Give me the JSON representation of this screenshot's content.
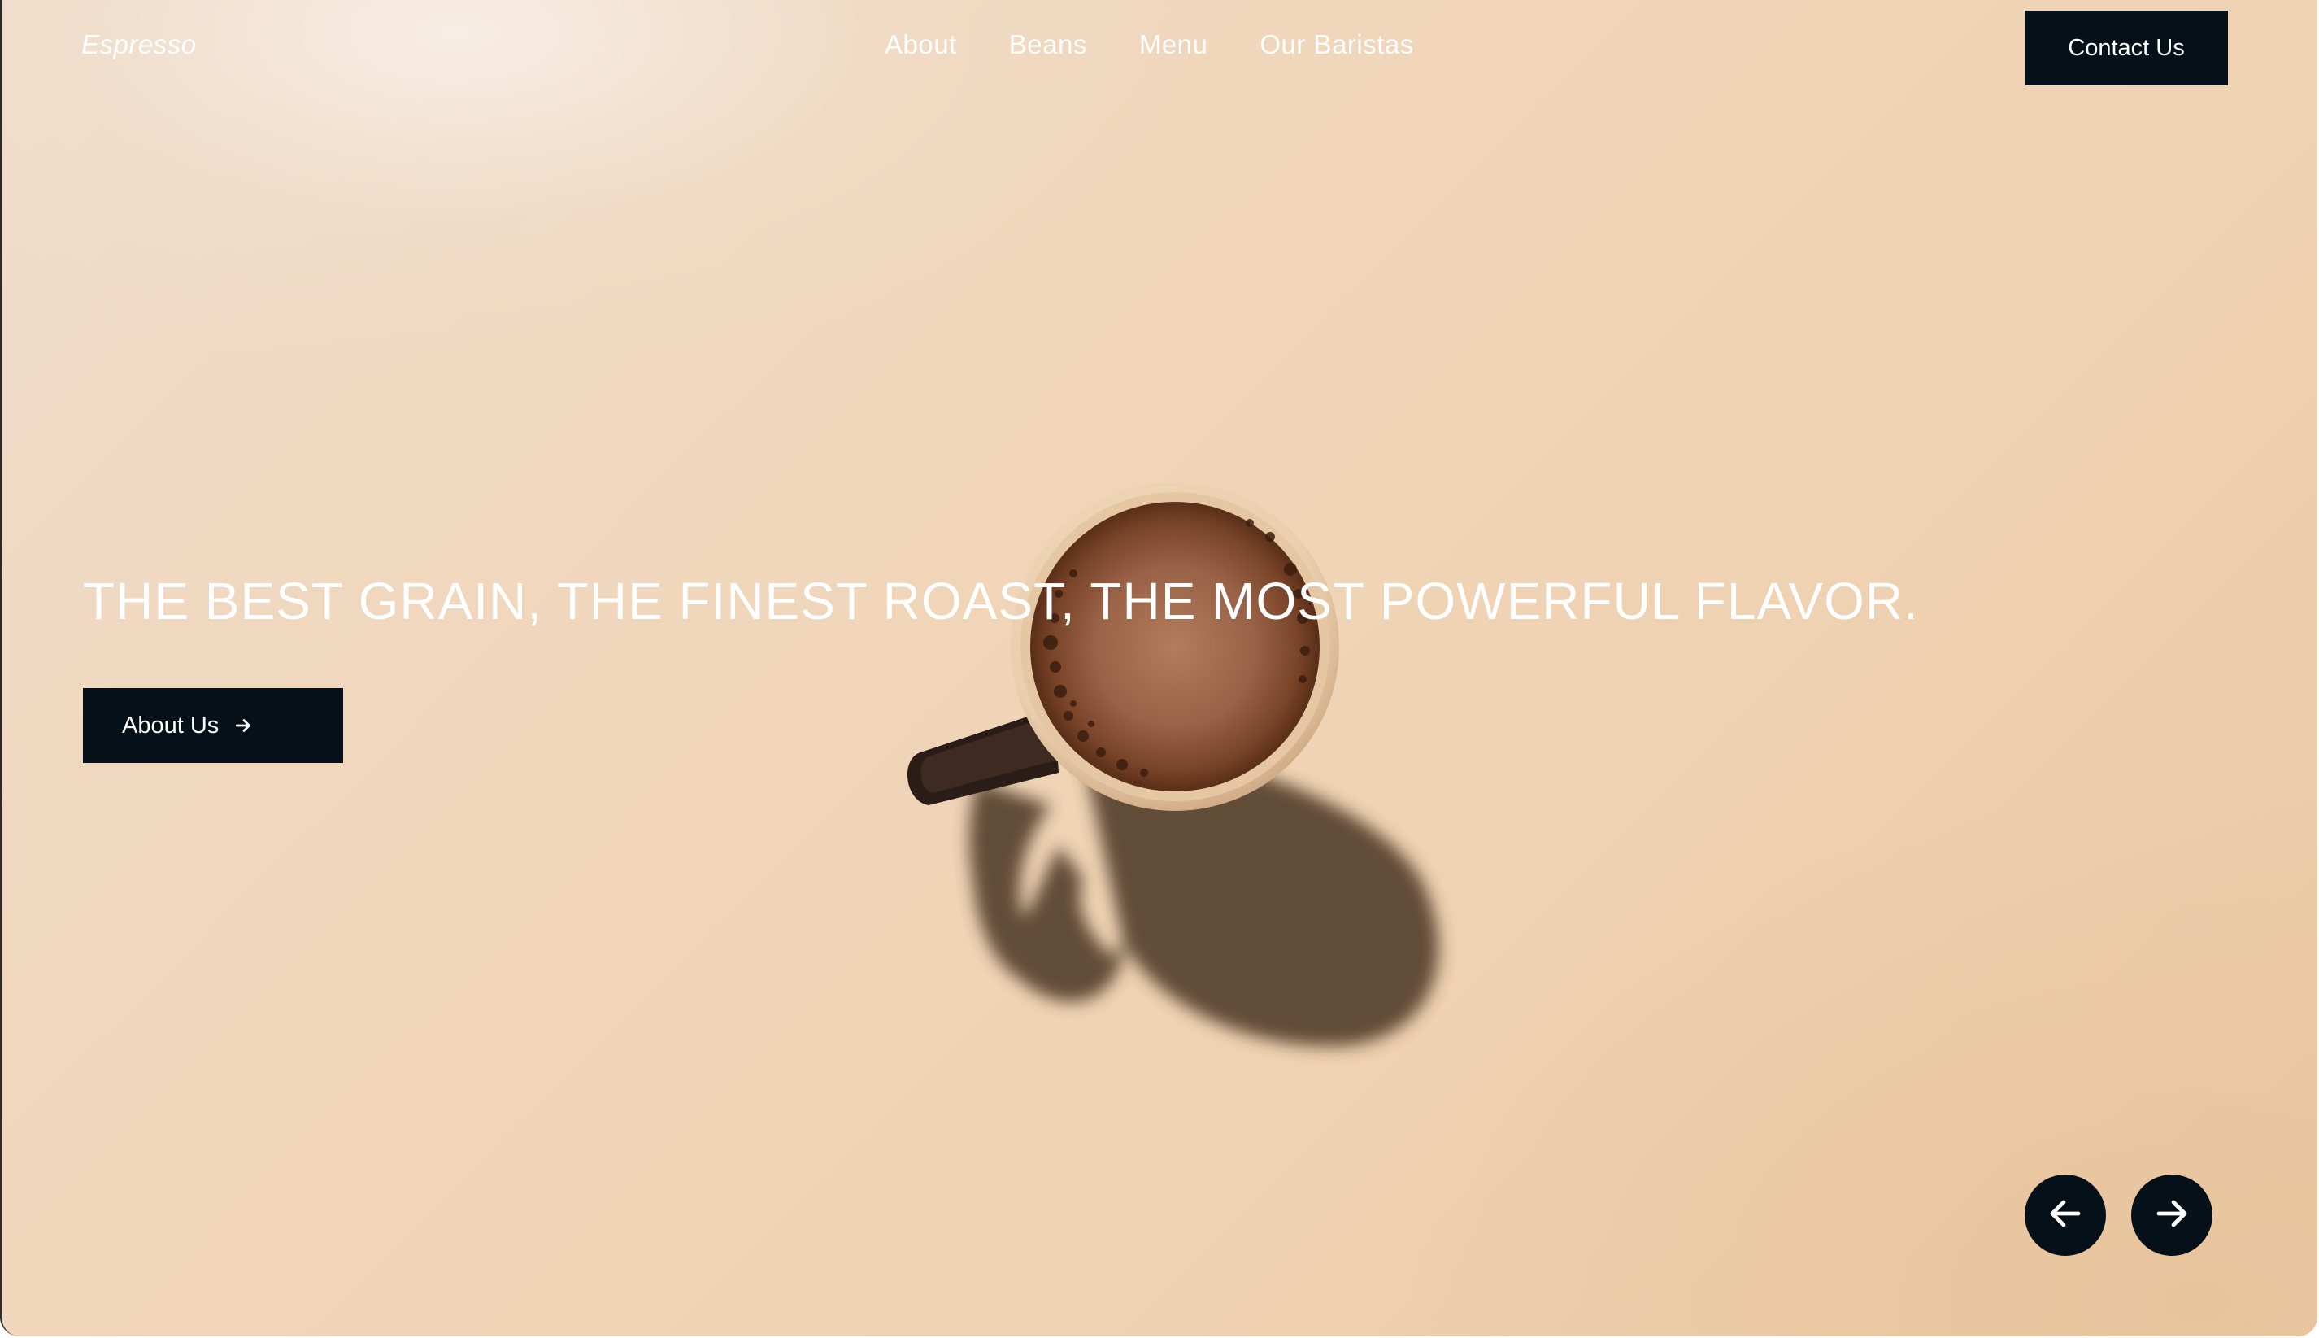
{
  "brand": "Espresso",
  "nav": {
    "items": [
      "About",
      "Beans",
      "Menu",
      "Our Baristas"
    ]
  },
  "header": {
    "contact_label": "Contact Us"
  },
  "hero": {
    "headline": "THE BEST GRAIN, THE FINEST ROAST, THE MOST POWERFUL FLAVOR.",
    "cta_label": "About Us",
    "cta_icon": "arrow-right-icon"
  },
  "slider": {
    "prev_icon": "arrow-left-icon",
    "next_icon": "arrow-right-icon"
  },
  "colors": {
    "button_bg": "#061019",
    "text_light": "#ffffff",
    "background": "#efd5b8"
  }
}
